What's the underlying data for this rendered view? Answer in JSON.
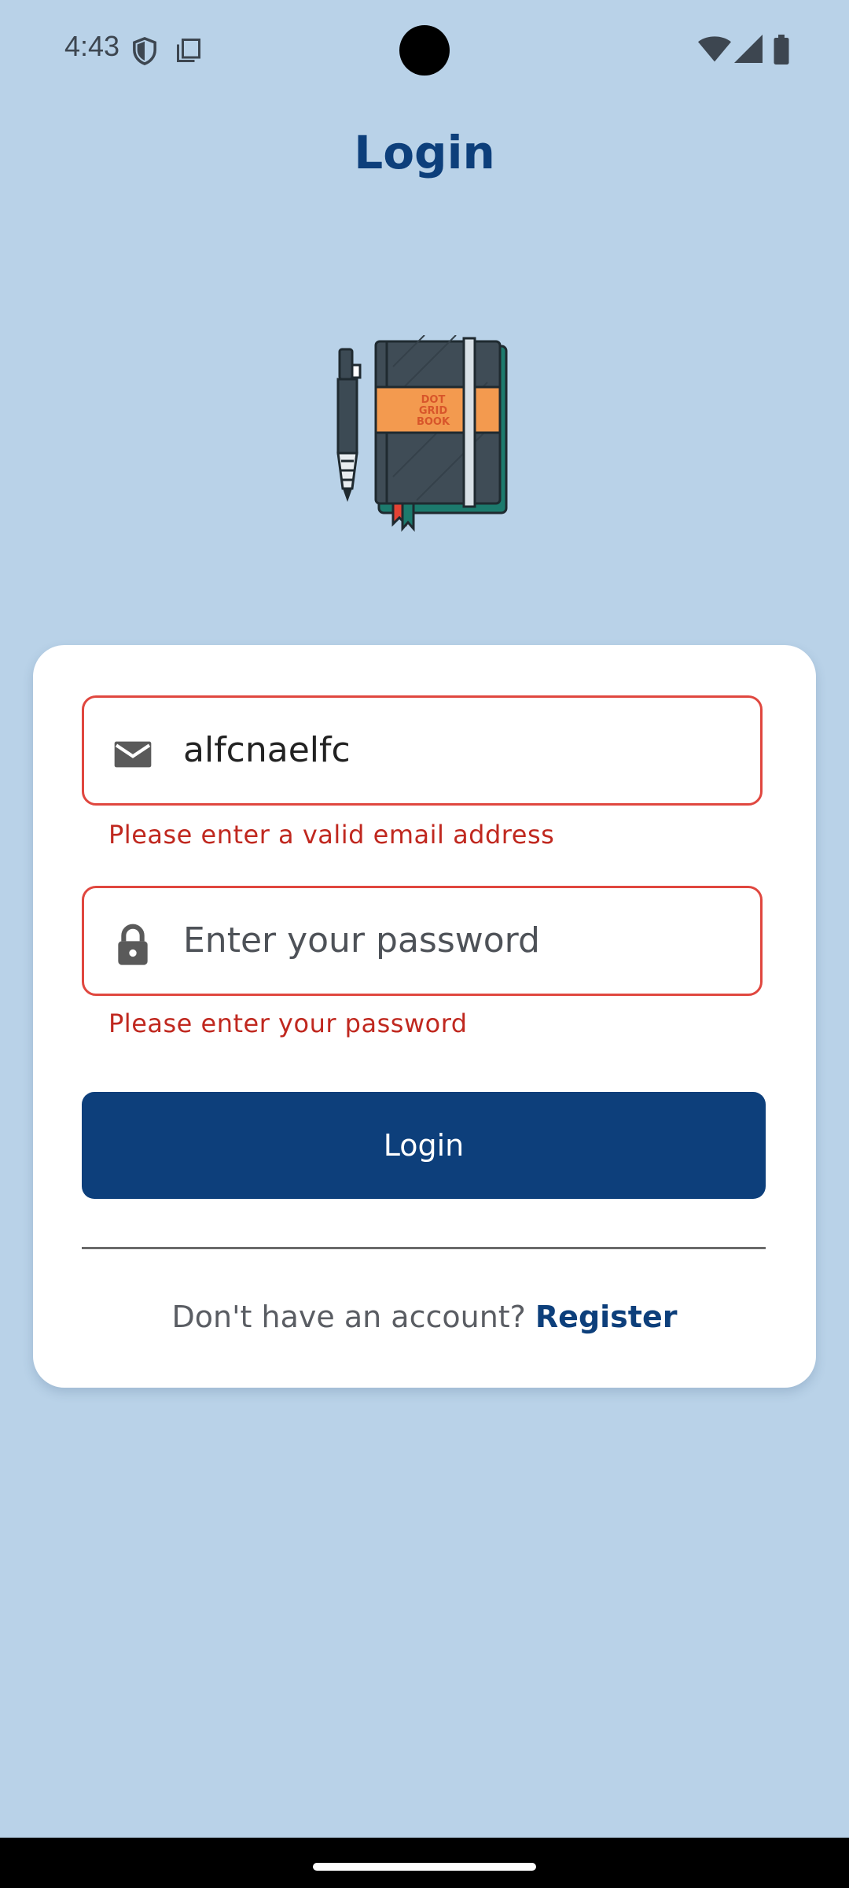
{
  "status_bar": {
    "time": "4:43",
    "icons": [
      "shield-icon",
      "copy-icon",
      "wifi-icon",
      "signal-icon",
      "battery-icon"
    ]
  },
  "header": {
    "title": "Login"
  },
  "logo": {
    "icon": "notebook-pen-logo",
    "text_lines": [
      "DOT",
      "GRID",
      "BOOK"
    ]
  },
  "form": {
    "email": {
      "icon": "mail-icon",
      "value": "alfcnaelfc",
      "error": "Please enter a valid email address"
    },
    "password": {
      "icon": "lock-icon",
      "placeholder": "Enter your password",
      "value": "",
      "error": "Please enter your password"
    },
    "login_button_label": "Login",
    "register_prompt": "Don't have an account?",
    "register_link": "Register"
  },
  "colors": {
    "background": "#b9d2e8",
    "primary": "#0d3f7b",
    "error": "#c0281f",
    "error_border": "#e0473f",
    "card": "#ffffff"
  }
}
